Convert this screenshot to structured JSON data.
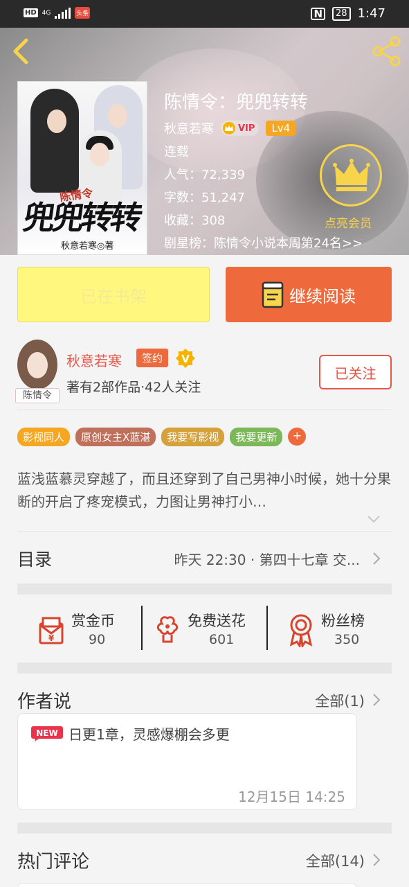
{
  "status_bar": {
    "hd": "HD",
    "network": "4G",
    "app_badge": "头条",
    "nfc": "N",
    "battery": "28",
    "time": "1:47"
  },
  "book": {
    "title": "陈情令：兜兜转转",
    "author": "秋意若寒",
    "vip_label": "VIP",
    "level": "Lv4",
    "status": "连载",
    "popularity": "人气：72,339",
    "word_count": "字数：51,247",
    "favorites": "收藏：308",
    "ranking": "剧星榜：陈情令小说本周第24名>>",
    "cover": {
      "tag": "陈情令",
      "title": "兜兜转转",
      "author_line": "秋意若寒◎著"
    }
  },
  "member": {
    "label": "点亮会员"
  },
  "actions": {
    "shelf_label": "已在书架",
    "read_label": "继续阅读"
  },
  "author_info": {
    "name": "秋意若寒",
    "signed_label": "签约",
    "avatar_tag": "陈情令",
    "summary": "著有2部作品·42人关注",
    "follow_label": "已关注"
  },
  "tags": [
    {
      "label": "影视同人",
      "color": "#f5a623"
    },
    {
      "label": "原创女主X蓝湛",
      "color": "#c0705a"
    },
    {
      "label": "我要写影视",
      "color": "#d4a13a"
    },
    {
      "label": "我要更新",
      "color": "#7cb85a"
    }
  ],
  "tag_more": "+",
  "synopsis": "蓝浅蓝慕灵穿越了，而且还穿到了自己男神小时候，她十分果断的开启了疼宠模式，力图让男神打小…",
  "toc": {
    "label": "目录",
    "latest": "昨天 22:30 · 第四十七章 交..."
  },
  "stats": [
    {
      "label": "赏金币",
      "value": "90",
      "icon": "red-envelope-icon"
    },
    {
      "label": "免费送花",
      "value": "601",
      "icon": "flower-icon"
    },
    {
      "label": "粉丝榜",
      "value": "350",
      "icon": "medal-icon"
    }
  ],
  "author_says": {
    "title": "作者说",
    "more": "全部(1)",
    "new_badge": "NEW",
    "text": "日更1章，灵感爆棚会多更",
    "date": "12月15日  14:25"
  },
  "hot_comments": {
    "title": "热门评论",
    "more": "全部(14)"
  },
  "colors": {
    "accent": "#ee6a3d",
    "gold": "#f7d44a",
    "shelf": "#fff77e"
  }
}
